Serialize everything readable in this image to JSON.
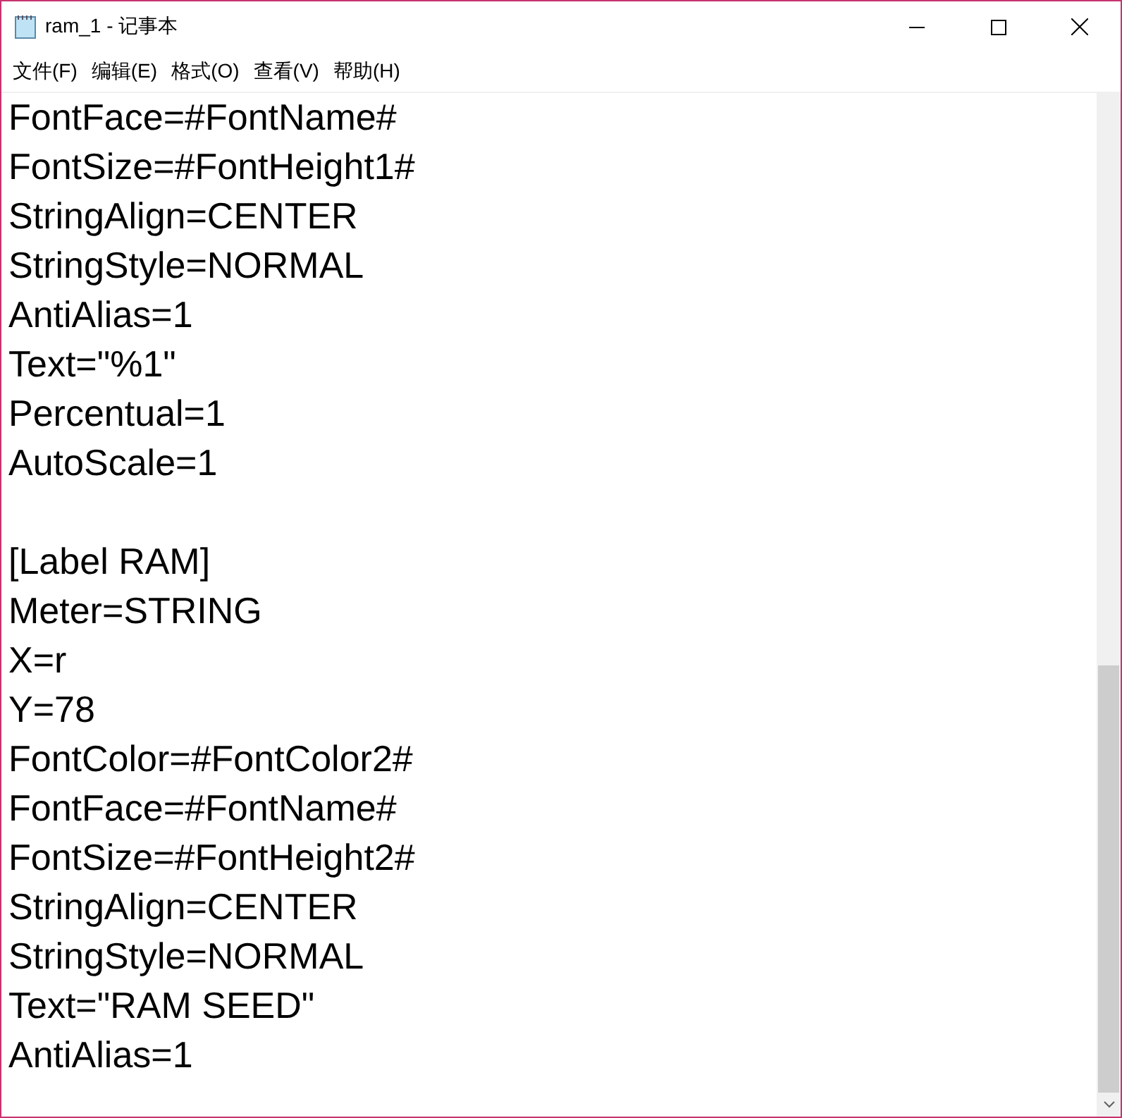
{
  "window": {
    "title": "ram_1 - 记事本"
  },
  "menu": [
    "文件(F)",
    "编辑(E)",
    "格式(O)",
    "查看(V)",
    "帮助(H)"
  ],
  "editor": {
    "blocks": [
      [
        "FontFace=#FontName#",
        "FontSize=#FontHeight1#",
        "StringAlign=CENTER",
        "StringStyle=NORMAL",
        "AntiAlias=1",
        "Text=\"%1\"",
        "Percentual=1",
        "AutoScale=1"
      ],
      [
        "[Label RAM]",
        "Meter=STRING",
        "X=r",
        "Y=78",
        "FontColor=#FontColor2#",
        "FontFace=#FontName#",
        "FontSize=#FontHeight2#",
        "StringAlign=CENTER",
        "StringStyle=NORMAL",
        "Text=\"RAM SEED\"",
        "AntiAlias=1"
      ]
    ]
  }
}
